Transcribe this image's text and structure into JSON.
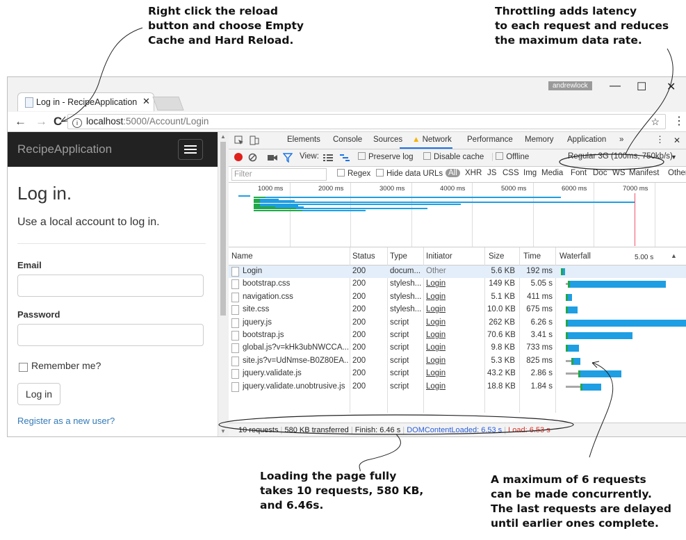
{
  "annotations": {
    "reload": "Right click the reload\nbutton and choose Empty\nCache and Hard Reload.",
    "throttle": "Throttling adds latency\nto each request and reduces\nthe maximum data rate.",
    "summary": "Loading the page fully\ntakes 10 requests, 580 KB,\nand 6.46s.",
    "concurrency": "A maximum of 6 requests\ncan be made concurrently.\nThe last requests are delayed\nuntil earlier ones complete."
  },
  "browser": {
    "tab_title": "Log in - RecipeApplication",
    "tab_close": "✕",
    "user_badge": "andrewlock",
    "url_host": "localhost",
    "url_path": ":5000/Account/Login",
    "win_min": "—",
    "win_max": "☐",
    "win_close": "✕",
    "icon_back": "←",
    "icon_forward": "→",
    "icon_reload": "C",
    "icon_star": "☆",
    "icon_menu": "⋮"
  },
  "site": {
    "brand": "RecipeApplication",
    "heading": "Log in.",
    "subheading": "Use a local account to log in.",
    "email_label": "Email",
    "password_label": "Password",
    "remember_label": "Remember me?",
    "login_button": "Log in",
    "register_link": "Register as a new user?"
  },
  "devtools": {
    "tabs": [
      "Elements",
      "Console",
      "Sources",
      "Network",
      "Performance",
      "Memory",
      "Application",
      "»"
    ],
    "icons": {
      "more": "⋮",
      "close": "✕",
      "dropdown": "▼",
      "sort": "▲"
    },
    "toolbar": {
      "view_label": "View:",
      "preserve_log": "Preserve log",
      "disable_cache": "Disable cache",
      "offline": "Offline",
      "throttling": "Regular 3G (100ms, 750kb/s)"
    },
    "filter": {
      "placeholder": "Filter",
      "regex": "Regex",
      "hide_data_urls": "Hide data URLs",
      "types": [
        "All",
        "XHR",
        "JS",
        "CSS",
        "Img",
        "Media",
        "Font",
        "Doc",
        "WS",
        "Manifest",
        "Other"
      ]
    },
    "timeline_ticks": [
      "1000 ms",
      "2000 ms",
      "3000 ms",
      "4000 ms",
      "5000 ms",
      "6000 ms",
      "7000 ms"
    ],
    "columns": [
      "Name",
      "Status",
      "Type",
      "Initiator",
      "Size",
      "Time",
      "Waterfall"
    ],
    "waterfall_scale": "5.00 s",
    "requests": [
      {
        "name": "Login",
        "status": "200",
        "type": "docum...",
        "initiator": "Other",
        "size": "5.6 KB",
        "time": "192 ms",
        "wait_start_s": 0.0,
        "wait_s": 0.0,
        "dl_s": 0.19
      },
      {
        "name": "bootstrap.css",
        "status": "200",
        "type": "stylesh...",
        "initiator": "Login",
        "size": "149 KB",
        "time": "5.05 s",
        "wait_start_s": 0.25,
        "wait_s": 0.2,
        "dl_s": 4.85
      },
      {
        "name": "navigation.css",
        "status": "200",
        "type": "stylesh...",
        "initiator": "Login",
        "size": "5.1 KB",
        "time": "411 ms",
        "wait_start_s": 0.25,
        "wait_s": 0.1,
        "dl_s": 0.31
      },
      {
        "name": "site.css",
        "status": "200",
        "type": "stylesh...",
        "initiator": "Login",
        "size": "10.0 KB",
        "time": "675 ms",
        "wait_start_s": 0.25,
        "wait_s": 0.1,
        "dl_s": 0.58
      },
      {
        "name": "jquery.js",
        "status": "200",
        "type": "script",
        "initiator": "Login",
        "size": "262 KB",
        "time": "6.26 s",
        "wait_start_s": 0.25,
        "wait_s": 0.1,
        "dl_s": 6.16
      },
      {
        "name": "bootstrap.js",
        "status": "200",
        "type": "script",
        "initiator": "Login",
        "size": "70.6 KB",
        "time": "3.41 s",
        "wait_start_s": 0.25,
        "wait_s": 0.1,
        "dl_s": 3.31
      },
      {
        "name": "global.js?v=kHk3ubNWCCA...",
        "status": "200",
        "type": "script",
        "initiator": "Login",
        "size": "9.8 KB",
        "time": "733 ms",
        "wait_start_s": 0.25,
        "wait_s": 0.1,
        "dl_s": 0.63
      },
      {
        "name": "site.js?v=UdNmse-B0Z80EA...",
        "status": "200",
        "type": "script",
        "initiator": "Login",
        "size": "5.3 KB",
        "time": "825 ms",
        "wait_start_s": 0.25,
        "wait_s": 0.35,
        "dl_s": 0.47
      },
      {
        "name": "jquery.validate.js",
        "status": "200",
        "type": "script",
        "initiator": "Login",
        "size": "43.2 KB",
        "time": "2.86 s",
        "wait_start_s": 0.25,
        "wait_s": 0.7,
        "dl_s": 2.16
      },
      {
        "name": "jquery.validate.unobtrusive.js",
        "status": "200",
        "type": "script",
        "initiator": "Login",
        "size": "18.8 KB",
        "time": "1.84 s",
        "wait_start_s": 0.25,
        "wait_s": 0.8,
        "dl_s": 1.04
      }
    ],
    "summary": {
      "requests": "10 requests",
      "transferred": "580 KB transferred",
      "finish": "Finish: 6.46 s",
      "domcontentloaded": "DOMContentLoaded: 6.53 s",
      "load": "Load: 6.53 s"
    },
    "colors": {
      "waiting": "#a8a8a8",
      "ttfb": "#20a84a",
      "download": "#1e9ee3",
      "load_line": "#e56b6b"
    }
  }
}
